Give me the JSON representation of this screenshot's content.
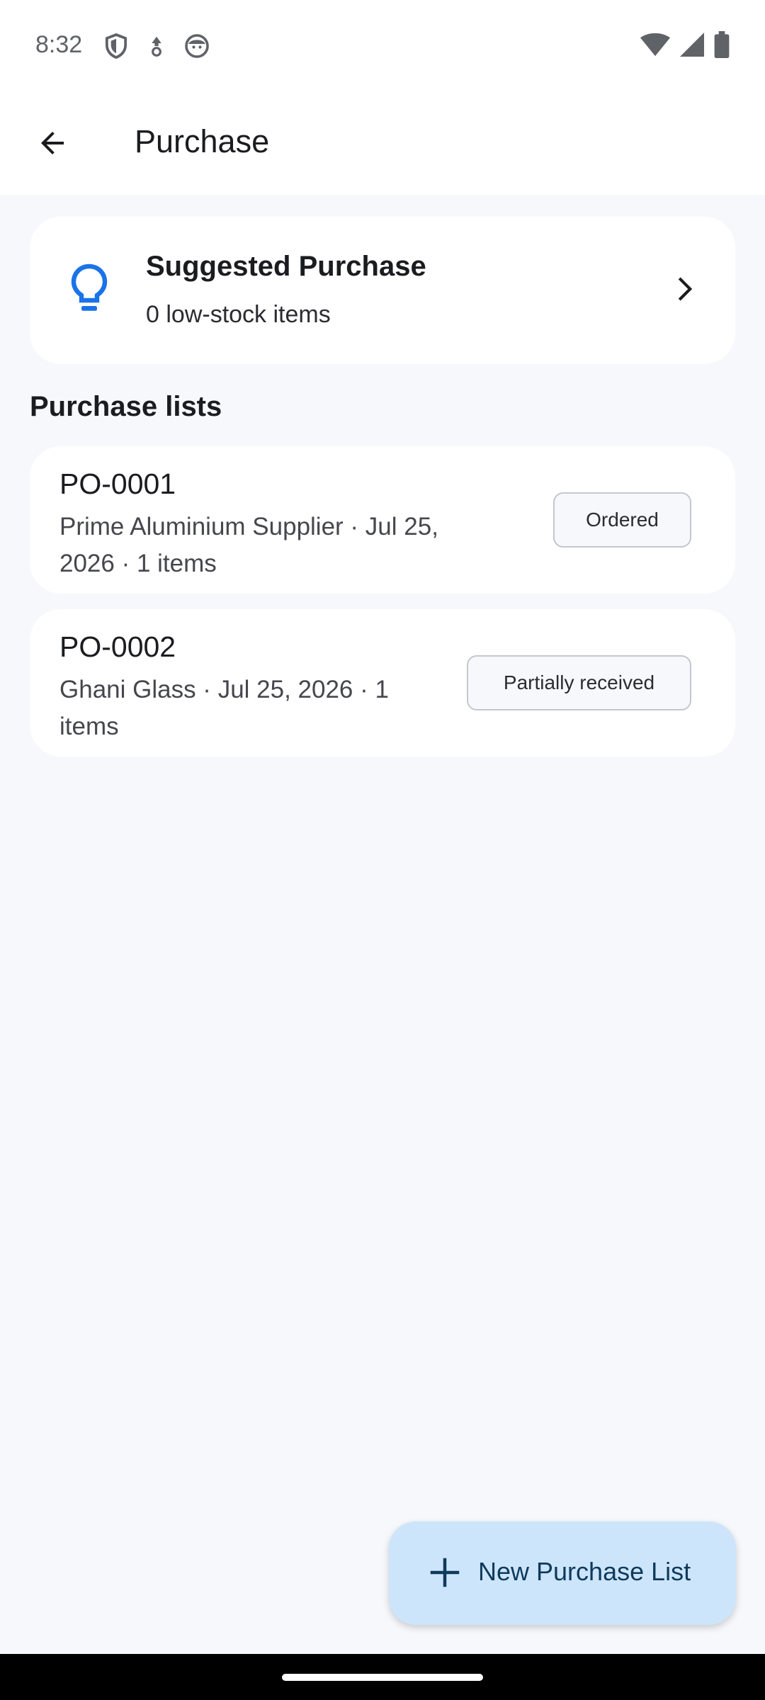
{
  "status_bar": {
    "time": "8:32",
    "left_icons": [
      "shield-icon",
      "alert-drop-icon",
      "face-icon"
    ],
    "right_icons": [
      "wifi-icon",
      "signal-icon",
      "battery-icon"
    ]
  },
  "app_bar": {
    "title": "Purchase",
    "back_icon": "arrow-left-icon"
  },
  "suggested": {
    "title": "Suggested Purchase",
    "subtitle": "0 low-stock items",
    "icon": "lightbulb-icon",
    "accent_color": "#1a73e8"
  },
  "section": {
    "title": "Purchase lists"
  },
  "purchase_lists": [
    {
      "number": "PO-0001",
      "detail_line1": "Prime Aluminium Supplier · Jul 25,",
      "detail_line2": "2026 · 1 items",
      "status": "Ordered"
    },
    {
      "number": "PO-0002",
      "detail_line1": "Ghani Glass · Jul 25, 2026 · 1",
      "detail_line2": "items",
      "status": "Partially received"
    }
  ],
  "fab": {
    "label": "New Purchase List",
    "icon": "plus-icon",
    "color": "#cde5fa"
  }
}
